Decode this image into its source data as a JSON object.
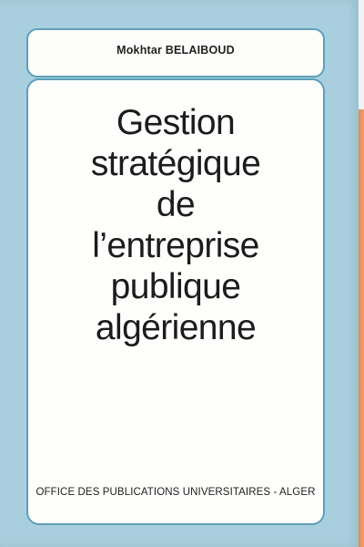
{
  "cover": {
    "author": "Mokhtar BELAIBOUD",
    "title_lines": [
      "Gestion",
      "stratégique",
      "de",
      "l’entreprise",
      "publique",
      "algérienne"
    ],
    "publisher": "OFFICE DES PUBLICATIONS UNIVERSITAIRES - ALGER"
  },
  "colors": {
    "cover_blue": "#a9cfde",
    "frame_border": "#5d9fb8",
    "panel_white": "#fefefc",
    "spine_orange": "#e0824a"
  }
}
